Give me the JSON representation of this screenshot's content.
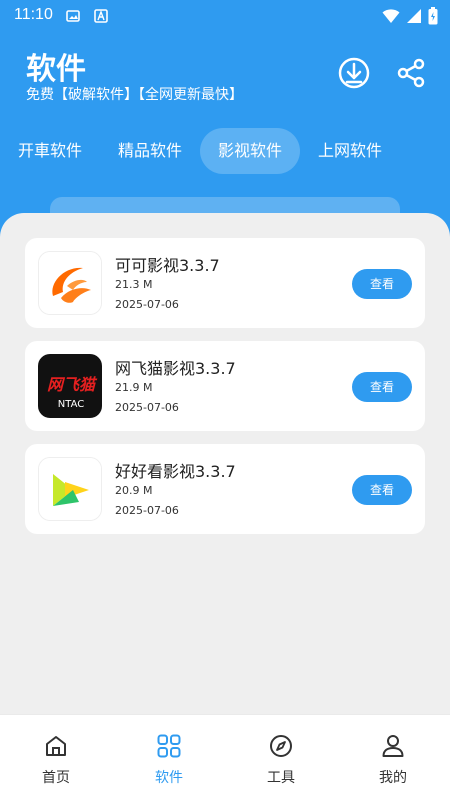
{
  "status_bar": {
    "time": "11:10"
  },
  "header": {
    "title": "软件",
    "subtitle": "免费【破解软件】【全网更新最快】"
  },
  "tabs": [
    {
      "label": "开車软件",
      "active": false
    },
    {
      "label": "精品软件",
      "active": false
    },
    {
      "label": "影视软件",
      "active": true
    },
    {
      "label": "上网软件",
      "active": false
    }
  ],
  "apps": [
    {
      "name": "可可影视3.3.7",
      "size": "21.3 M",
      "date": "2025-07-06",
      "button": "查看",
      "icon": "keke-logo-icon"
    },
    {
      "name": "网飞猫影视3.3.7",
      "size": "21.9 M",
      "date": "2025-07-06",
      "button": "查看",
      "icon": "netflix-cat-logo-icon",
      "icon_text": "网飞猫",
      "icon_subtext": "NTAC"
    },
    {
      "name": "好好看影视3.3.7",
      "size": "20.9 M",
      "date": "2025-07-06",
      "button": "查看",
      "icon": "haohaokan-logo-icon"
    }
  ],
  "bottom_nav": [
    {
      "label": "首页",
      "icon": "home-icon",
      "active": false
    },
    {
      "label": "软件",
      "icon": "grid-icon",
      "active": true
    },
    {
      "label": "工具",
      "icon": "compass-icon",
      "active": false
    },
    {
      "label": "我的",
      "icon": "user-icon",
      "active": false
    }
  ],
  "colors": {
    "primary": "#2f9bf0",
    "panel": "#efefef"
  }
}
